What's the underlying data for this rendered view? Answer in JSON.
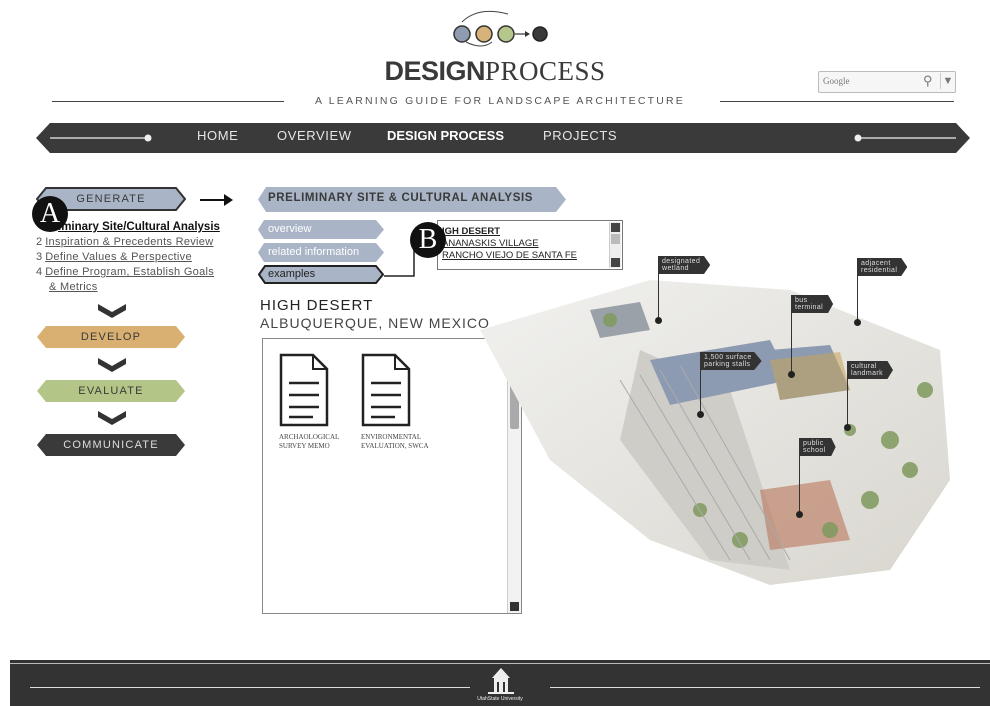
{
  "header": {
    "title_bold": "DESIGN",
    "title_rest": "PROCESS",
    "subtitle": "A LEARNING GUIDE FOR LANDSCAPE ARCHITECTURE",
    "search": {
      "placeholder": "Google"
    },
    "logo_colors": [
      "#8e9bb0",
      "#d7b27a",
      "#b6c78c",
      "#3a3a3a"
    ]
  },
  "nav": {
    "items": [
      {
        "label": "HOME"
      },
      {
        "label": "OVERVIEW"
      },
      {
        "label": "DESIGN PROCESS"
      },
      {
        "label": "PROJECTS"
      }
    ]
  },
  "stages": {
    "generate": "GENERATE",
    "develop": "DEVELOP",
    "evaluate": "EVALUATE",
    "communicate": "COMMUNICATE",
    "colors": {
      "generate": "#a9b5c6",
      "develop": "#d9b072",
      "evaluate": "#b4c588",
      "communicate": "#3a3a3a"
    }
  },
  "steps": [
    {
      "num": "1",
      "label": "Preliminary Site/Cultural Analysis",
      "shown": "iminary Site/Cultural Analysis"
    },
    {
      "num": "2",
      "label": "Inspiration & Precedents Review"
    },
    {
      "num": "3",
      "label": "Define Values & Perspective"
    },
    {
      "num": "4",
      "label": "Define Program, Establish Goals"
    },
    {
      "num": "",
      "label": "& Metrics"
    }
  ],
  "section": {
    "title": "PRELIMINARY SITE & CULTURAL ANALYSIS",
    "tabs": [
      {
        "label": "overview"
      },
      {
        "label": "related information"
      },
      {
        "label": "examples"
      }
    ],
    "examples": [
      "HIGH DESERT",
      "KANANASKIS VILLAGE",
      "RANCHO VIEJO DE SANTA FE"
    ],
    "examples_shown": [
      "IGH DESERT",
      "ANANASKIS VILLAGE",
      "RANCHO VIEJO DE SANTA FE"
    ]
  },
  "project": {
    "name": "HIGH DESERT",
    "location": "ALBUQUERQUE, NEW MEXICO",
    "documents": [
      {
        "label_line1": "ARCHAOLOGICAL",
        "label_line2": "SURVEY MEMO"
      },
      {
        "label_line1": "ENVIRONMENTAL",
        "label_line2": "EVALUATION, SWCA"
      }
    ]
  },
  "badges": {
    "a": "A",
    "b": "B"
  },
  "site_plan_labels": [
    {
      "line1": "designated",
      "line2": "wetland"
    },
    {
      "line1": "adjacent",
      "line2": "residential"
    },
    {
      "line1": "bus",
      "line2": "terminal"
    },
    {
      "line1": "1,500 surface",
      "line2": "parking stalls"
    },
    {
      "line1": "cultural",
      "line2": "landmark"
    },
    {
      "line1": "public",
      "line2": "school"
    }
  ],
  "footer": {
    "logo_text": "UtahState University"
  }
}
